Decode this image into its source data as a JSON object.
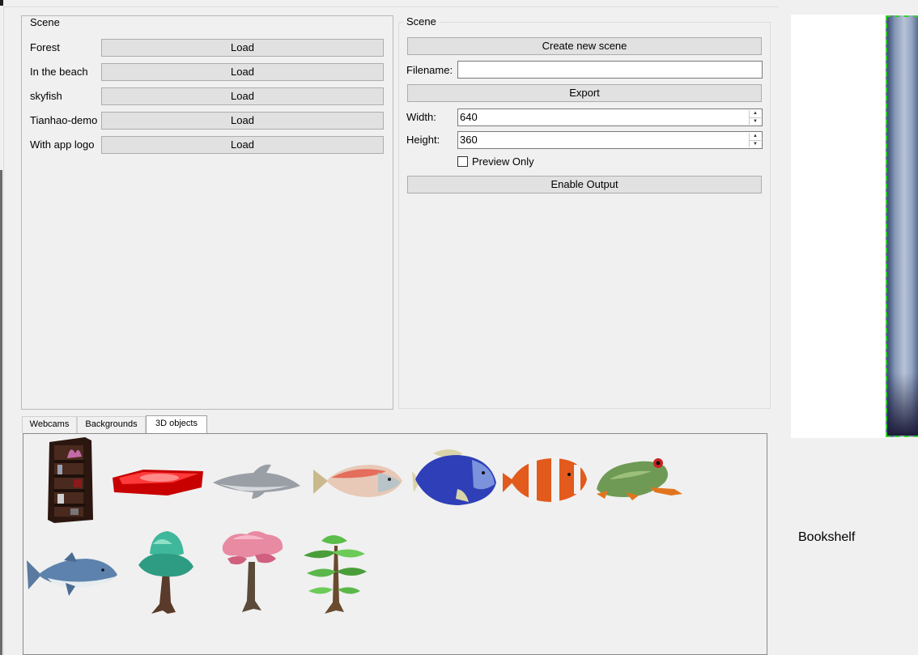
{
  "scene_list": {
    "title": "Scene",
    "load_label": "Load",
    "items": [
      {
        "name": "Forest"
      },
      {
        "name": "In the beach"
      },
      {
        "name": "skyfish"
      },
      {
        "name": "Tianhao-demo"
      },
      {
        "name": "With app logo"
      }
    ]
  },
  "scene_panel": {
    "title": "Scene",
    "create_label": "Create new scene",
    "filename_label": "Filename:",
    "filename_value": "",
    "export_label": "Export",
    "width_label": "Width:",
    "width_value": "640",
    "height_label": "Height:",
    "height_value": "360",
    "preview_only_label": "Preview Only",
    "preview_only_checked": false,
    "enable_output_label": "Enable Output"
  },
  "tabs": [
    {
      "label": "Webcams",
      "active": false
    },
    {
      "label": "Backgrounds",
      "active": false
    },
    {
      "label": "3D objects",
      "active": true
    }
  ],
  "objects_3d": [
    {
      "icon": "bookshelf-icon"
    },
    {
      "icon": "red-slab-icon"
    },
    {
      "icon": "dolphin-icon"
    },
    {
      "icon": "tuna-icon"
    },
    {
      "icon": "blue-fish-icon"
    },
    {
      "icon": "clownfish-icon"
    },
    {
      "icon": "frog-icon"
    },
    {
      "icon": "shark-icon"
    },
    {
      "icon": "teal-tree-icon"
    },
    {
      "icon": "pink-tree-icon"
    },
    {
      "icon": "green-tree-icon"
    }
  ],
  "preview": {
    "selected_label": "Bookshelf"
  },
  "colors": {
    "window_bg": "#f0f0f0",
    "button_bg": "#e1e1e1",
    "selection_outline": "#38d32e"
  }
}
